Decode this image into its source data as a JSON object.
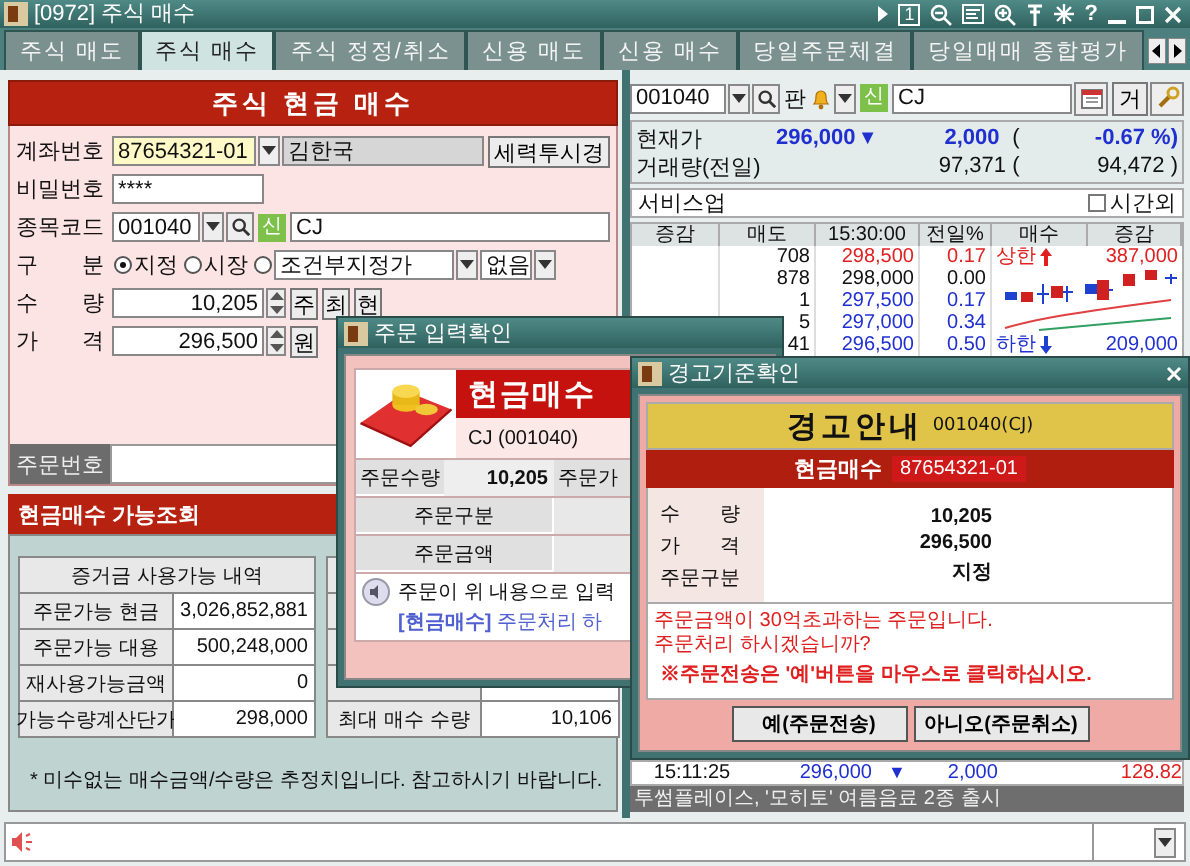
{
  "window": {
    "title": "[0972] 주식 매수",
    "screen_number": "1",
    "help": "?"
  },
  "tabs": [
    {
      "label": "주식 매도",
      "selected": false
    },
    {
      "label": "주식 매수",
      "selected": true
    },
    {
      "label": "주식 정정/취소",
      "selected": false
    },
    {
      "label": "신용 매도",
      "selected": false
    },
    {
      "label": "신용 매수",
      "selected": false
    },
    {
      "label": "당일주문체결",
      "selected": false
    },
    {
      "label": "당일매매 종합평가",
      "selected": false
    }
  ],
  "order_form": {
    "title": "주식 현금 매수",
    "account": {
      "label": "계좌번호",
      "value": "87654321-01",
      "name": "김한국",
      "button": "세력투시경"
    },
    "password": {
      "label": "비밀번호",
      "value": "****"
    },
    "stock": {
      "label": "종목코드",
      "value": "001040",
      "badge": "신",
      "name": "CJ"
    },
    "order_type": {
      "label": "구 분",
      "options": [
        {
          "label": "지정",
          "selected": true
        },
        {
          "label": "시장",
          "selected": false
        },
        {
          "selected": false
        }
      ],
      "condition": "조건부지정가",
      "extra": "없음"
    },
    "quantity": {
      "label": "수 량",
      "value": "10,205",
      "buttons": [
        "주",
        "최",
        "현"
      ]
    },
    "price": {
      "label": "가 격",
      "value": "296,500",
      "buttons": [
        "원"
      ]
    },
    "order_number": {
      "label": "주문번호"
    }
  },
  "availability": {
    "title": "현금매수 가능조회",
    "table": {
      "header": "증거금 사용가능 내역",
      "rows": [
        [
          "주문가능 현금",
          "3,026,852,881"
        ],
        [
          "주문가능 대용",
          "500,248,000"
        ],
        [
          "재사용가능금액",
          "0"
        ],
        [
          "가능수량계산단가",
          "298,000"
        ]
      ]
    },
    "side_table": {
      "rows": [
        [
          "최대 매수 수량",
          "10,106"
        ]
      ]
    },
    "note": "* 미수없는 매수금액/수량은 추정치입니다.  참고하시기 바랍니다."
  },
  "quote": {
    "code": "001040",
    "badge_1": "판",
    "badge_2": "신",
    "name": "CJ",
    "button": "거",
    "price_label": "현재가",
    "price": "296,000",
    "color": "#2030d0",
    "arrow": "▼",
    "change": "2,000",
    "paren": "(",
    "rate": "-0.67 %)",
    "volume_label": "거래량(전일)",
    "volume": "97,371 (",
    "prev_volume": "94,472 )",
    "sector": "서비스업",
    "after_hours": {
      "label": "시간외",
      "checked": false
    }
  },
  "order_book": {
    "columns": [
      "증감",
      "매도",
      "15:30:00",
      "전일%",
      "매수",
      "증감"
    ],
    "asks": [
      {
        "volume": "708",
        "price": "298,500",
        "rate": "0.17",
        "color": "#e02020"
      },
      {
        "volume": "878",
        "price": "298,000",
        "rate": "0.00",
        "color": "#111111"
      },
      {
        "volume": "1",
        "price": "297,500",
        "rate": "0.17",
        "color": "#2030d0"
      },
      {
        "volume": "5",
        "price": "297,000",
        "rate": "0.34",
        "color": "#2030d0"
      },
      {
        "volume": "41",
        "price": "296,500",
        "rate": "0.50",
        "color": "#2030d0"
      }
    ],
    "upper_limit": {
      "label": "상한",
      "value": "387,000"
    },
    "lower_limit": {
      "label": "하한",
      "value": "209,000"
    },
    "trades": [
      {
        "time": "15:11:25",
        "price": "296,000",
        "arrow": "▼",
        "change": "2,000",
        "rate": "128.82",
        "color": "#2030d0"
      }
    ],
    "news": "투썸플레이스, '모히토' 여름음료 2종 출시"
  },
  "confirm_dialog": {
    "title": "주문 입력확인",
    "heading": "현금매수",
    "stock": "CJ (001040)",
    "qty_label": "주문수량",
    "qty": "10,205",
    "price_label": "주문가",
    "type_label": "주문구분",
    "amount_label": "주문금액",
    "message": "주문이 위 내용으로 입력",
    "footer": "**[현금매수]** 주문처리 하"
  },
  "warning_dialog": {
    "title": "경고기준확인",
    "heading": "경고안내",
    "code": "001040(CJ)",
    "order_kind": "현금매수",
    "account": "87654321-01",
    "rows": [
      {
        "label": "수 량",
        "value": "10,205"
      },
      {
        "label": "가 격",
        "value": "296,500"
      },
      {
        "label": "주문구분",
        "value": "지정"
      }
    ],
    "message_lines": [
      "주문금액이 30억초과하는 주문입니다.",
      "주문처리 하시겠습니까?"
    ],
    "notice": "※주문전송은 '예'버튼을 마우스로 클릭하십시오.",
    "buttons": [
      "예(주문전송)",
      "아니오(주문취소)"
    ]
  }
}
